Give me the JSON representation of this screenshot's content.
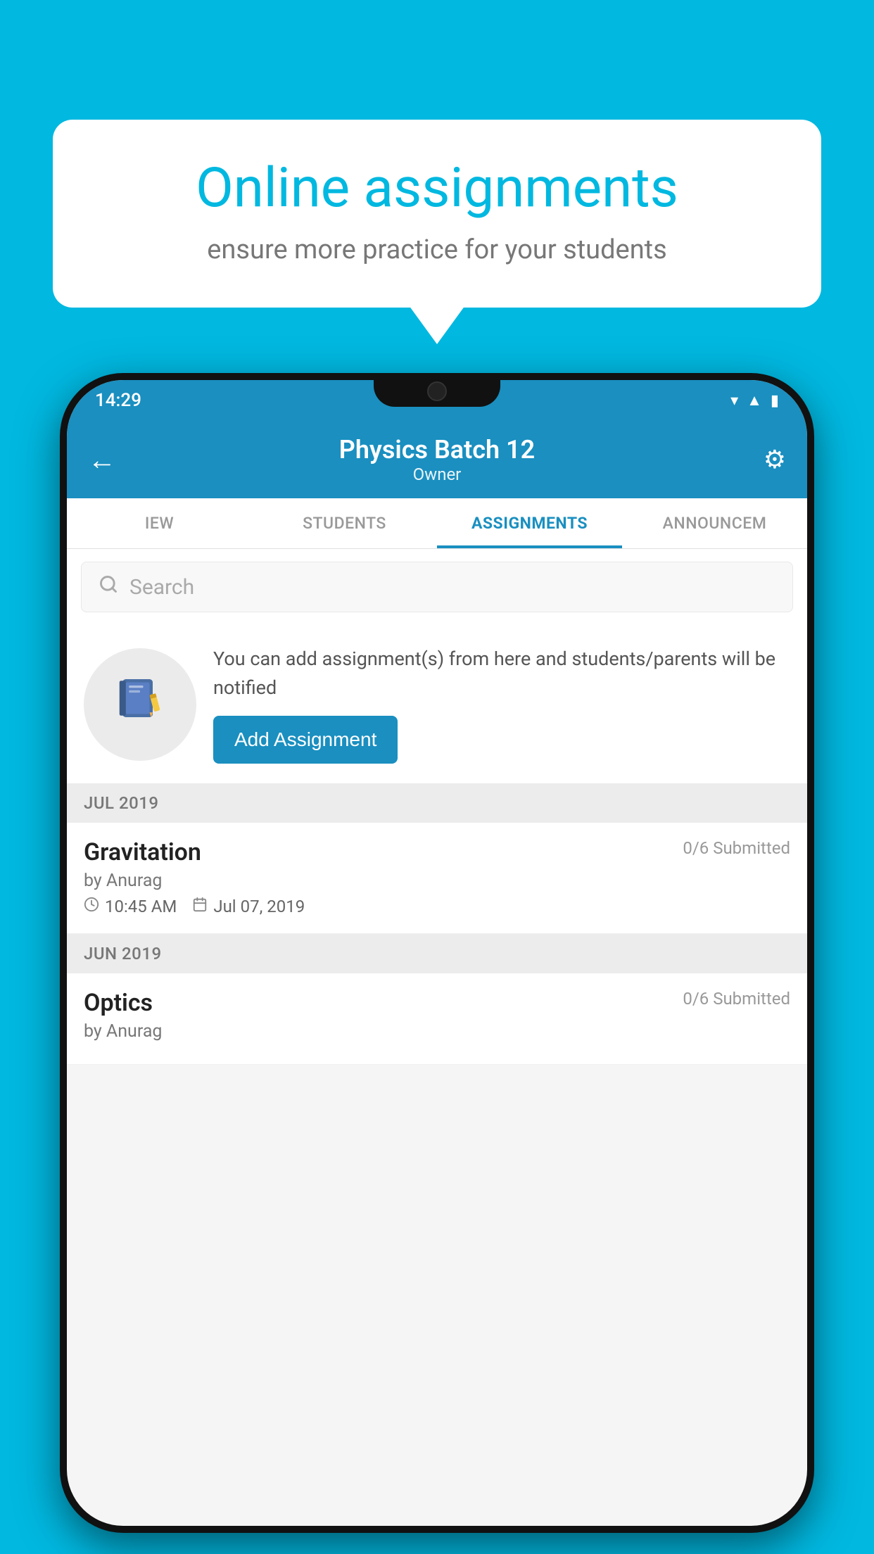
{
  "background_color": "#00b8e0",
  "bubble": {
    "title": "Online assignments",
    "subtitle": "ensure more practice for your students"
  },
  "phone": {
    "status_bar": {
      "time": "14:29",
      "icons": [
        "wifi",
        "signal",
        "battery"
      ]
    },
    "header": {
      "back_label": "←",
      "title": "Physics Batch 12",
      "subtitle": "Owner",
      "gear_label": "⚙"
    },
    "tabs": [
      {
        "label": "IEW",
        "active": false
      },
      {
        "label": "STUDENTS",
        "active": false
      },
      {
        "label": "ASSIGNMENTS",
        "active": true
      },
      {
        "label": "ANNOUNCEM",
        "active": false
      }
    ],
    "search": {
      "placeholder": "Search"
    },
    "prompt": {
      "text": "You can add assignment(s) from here and students/parents will be notified",
      "button_label": "Add Assignment"
    },
    "sections": [
      {
        "label": "JUL 2019",
        "assignments": [
          {
            "name": "Gravitation",
            "submitted": "0/6 Submitted",
            "author": "by Anurag",
            "time": "10:45 AM",
            "date": "Jul 07, 2019"
          }
        ]
      },
      {
        "label": "JUN 2019",
        "assignments": [
          {
            "name": "Optics",
            "submitted": "0/6 Submitted",
            "author": "by Anurag",
            "time": "",
            "date": ""
          }
        ]
      }
    ]
  }
}
